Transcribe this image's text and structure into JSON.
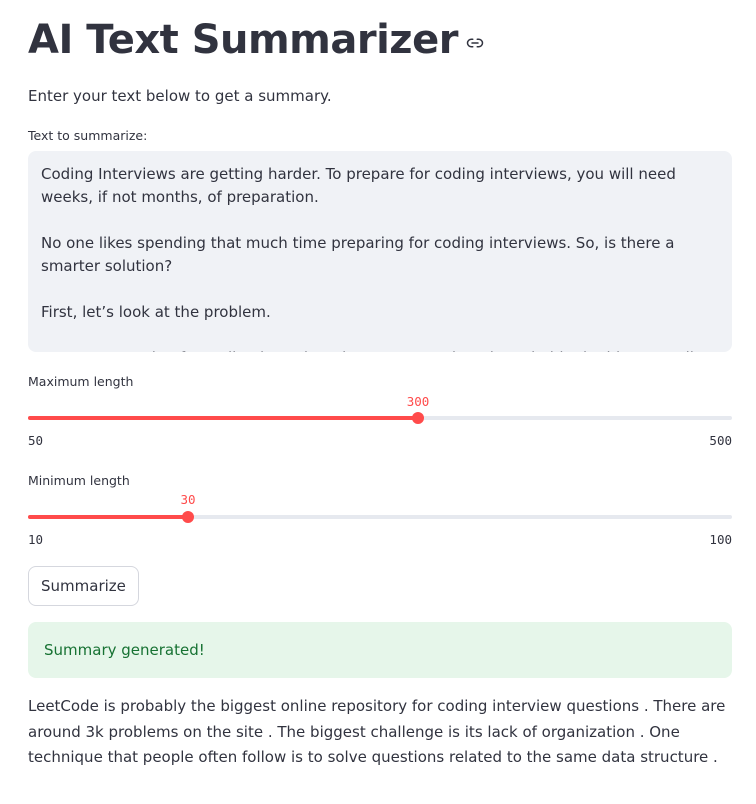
{
  "app": {
    "title": "AI Text Summarizer",
    "subtitle": "Enter your text below to get a summary."
  },
  "input": {
    "label": "Text to summarize:",
    "value": "Coding Interviews are getting harder. To prepare for coding interviews, you will need weeks, if not months, of preparation.\n\nNo one likes spending that much time preparing for coding interviews. So, is there a smarter solution?\n\nFirst, let’s look at the problem.\n\nAnyone preparing for coding interviews knows LeetCode. It is probably the biggest online repository"
  },
  "max_length": {
    "label": "Maximum length",
    "value": 300,
    "min": 50,
    "max": 500
  },
  "min_length": {
    "label": "Minimum length",
    "value": 30,
    "min": 10,
    "max": 100
  },
  "button": {
    "label": "Summarize"
  },
  "alert": {
    "text": "Summary generated!"
  },
  "summary": {
    "text": "LeetCode is probably the biggest online repository for coding interview questions . There are around 3k problems on the site . The biggest challenge is its lack of organization . One technique that people often follow is to solve questions related to the same data structure ."
  },
  "colors": {
    "accent": "#ff4b4b",
    "success_bg": "#e6f6ea",
    "success_text": "#177233",
    "input_bg": "#f0f2f6"
  },
  "icons": {
    "title_link": "link-icon"
  }
}
